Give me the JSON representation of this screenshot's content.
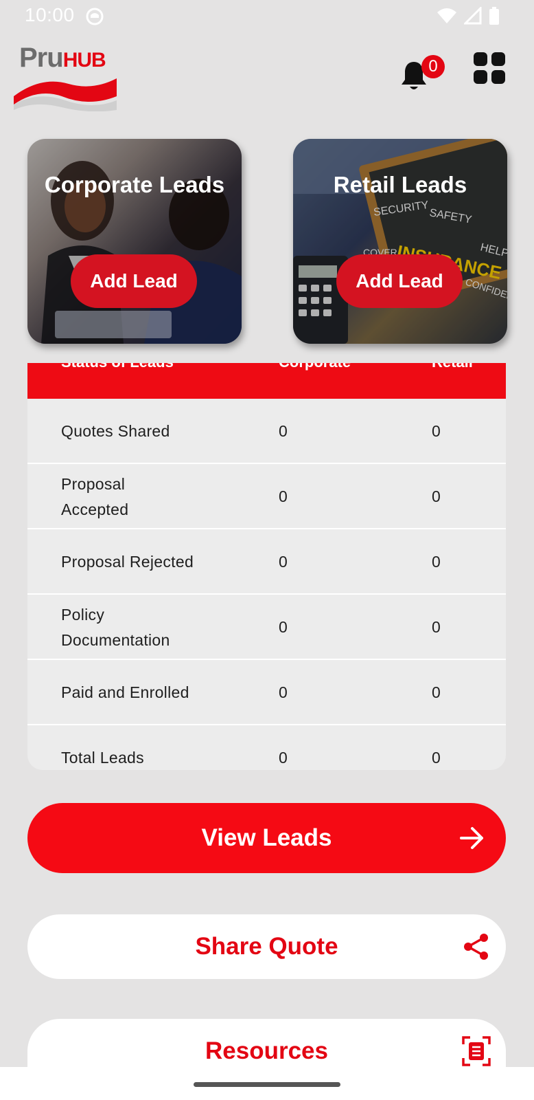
{
  "status_bar": {
    "time": "10:00"
  },
  "header": {
    "logo_text_main": "Pru",
    "logo_text_hub": "HUB",
    "notification_count": "0"
  },
  "cards": {
    "corporate": {
      "title": "Corporate Leads",
      "button": "Add Lead"
    },
    "retail": {
      "title": "Retail Leads",
      "button": "Add Lead",
      "image_words": [
        "SECURITY",
        "SAFETY",
        "INSURANCE",
        "HELP",
        "CONFIDENCE",
        "COVER"
      ]
    }
  },
  "table": {
    "headers": [
      "Status of Leads",
      "Corporate",
      "Retail"
    ],
    "rows": [
      {
        "label": "Quotes Shared",
        "corporate": "0",
        "retail": "0"
      },
      {
        "label": "Proposal Accepted",
        "corporate": "0",
        "retail": "0"
      },
      {
        "label": "Proposal Rejected",
        "corporate": "0",
        "retail": "0"
      },
      {
        "label": "Policy Documentation",
        "corporate": "0",
        "retail": "0"
      },
      {
        "label": "Paid and Enrolled",
        "corporate": "0",
        "retail": "0"
      },
      {
        "label": "Total Leads",
        "corporate": "0",
        "retail": "0"
      }
    ]
  },
  "actions": {
    "view_leads": "View Leads",
    "share_quote": "Share Quote",
    "resources": "Resources"
  },
  "colors": {
    "brand_red": "#e30613",
    "bright_red": "#f50a14",
    "background": "#e4e3e3"
  }
}
